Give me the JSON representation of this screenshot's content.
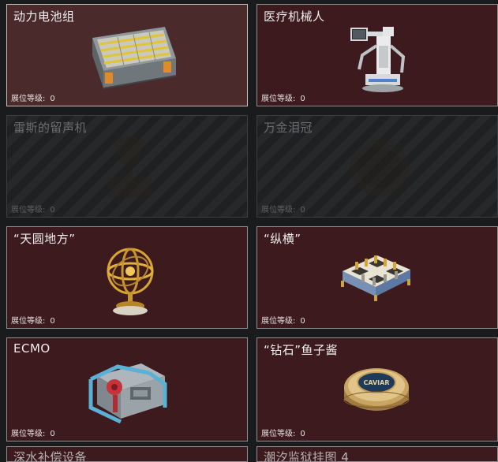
{
  "level_label": "展位等级:",
  "cards": [
    {
      "title": "动力电池组",
      "level": "0",
      "state": "highlight",
      "icon": "battery-pack-icon"
    },
    {
      "title": "医疗机械人",
      "level": "0",
      "state": "normal",
      "icon": "medical-robot-icon"
    },
    {
      "title": "雷斯的留声机",
      "level": "0",
      "state": "locked",
      "icon": "phonograph-icon"
    },
    {
      "title": "万金泪冠",
      "level": "0",
      "state": "locked",
      "icon": "crown-icon"
    },
    {
      "title": "“天圆地方”",
      "level": "0",
      "state": "normal",
      "icon": "armillary-sphere-icon"
    },
    {
      "title": "“纵横”",
      "level": "0",
      "state": "normal",
      "icon": "chess-board-icon"
    },
    {
      "title": "ECMO",
      "level": "0",
      "state": "normal",
      "icon": "ecmo-machine-icon"
    },
    {
      "title": "“钻石”鱼子酱",
      "level": "0",
      "state": "normal",
      "icon": "caviar-tin-icon"
    }
  ],
  "partial_cards": [
    {
      "title": "深水补偿设备"
    },
    {
      "title": "潮汐监狱挂图 4"
    }
  ],
  "caviar_label": "CAVIAR"
}
